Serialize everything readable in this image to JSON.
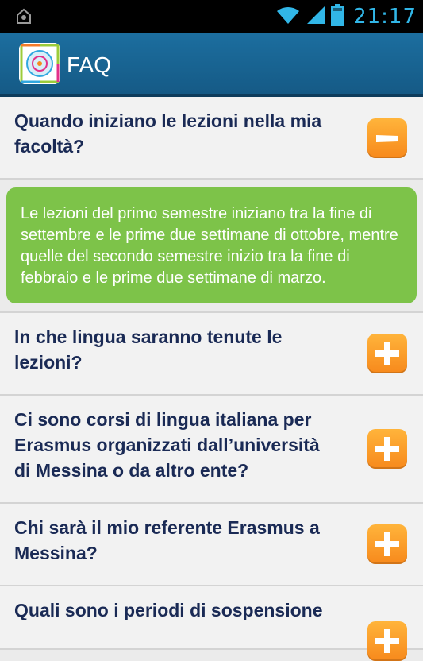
{
  "status_bar": {
    "time": "21:17",
    "icons": [
      "android-notification-icon",
      "wifi-icon",
      "signal-icon",
      "battery-icon"
    ]
  },
  "action_bar": {
    "title": "FAQ",
    "logo": "app-logo"
  },
  "colors": {
    "accent": "#1c6e9f",
    "toggle": "#f7891c",
    "answer": "#7dc349",
    "question_text": "#1a2a55"
  },
  "faq": [
    {
      "question": "Quando iniziano le lezioni nella mia facoltà?",
      "expanded": true,
      "answer": "Le lezioni del primo semestre iniziano tra la fine di settembre e le prime due settimane di ottobre, mentre quelle del secondo semestre inizio tra la fine di febbraio e le prime due settimane di marzo."
    },
    {
      "question": "In che lingua saranno tenute le lezioni?",
      "expanded": false
    },
    {
      "question": "Ci sono corsi di lingua italiana per Erasmus organizzati dall’università di Messina o da altro ente?",
      "expanded": false
    },
    {
      "question": "Chi sarà il mio referente Erasmus a Messina?",
      "expanded": false
    },
    {
      "question": "Quali sono i periodi di sospensione",
      "expanded": false
    }
  ]
}
